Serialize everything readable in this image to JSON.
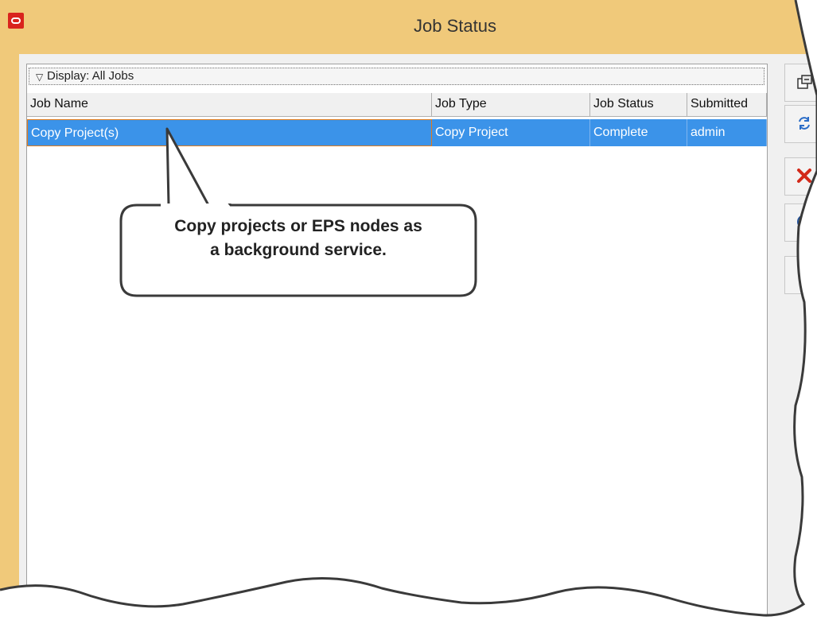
{
  "window": {
    "title": "Job Status"
  },
  "display_filter": {
    "label": "Display: All Jobs"
  },
  "table": {
    "columns": [
      "Job Name",
      "Job Type",
      "Job Status",
      "Submitted"
    ],
    "rows": [
      {
        "job_name": "Copy Project(s)",
        "job_type": "Copy Project",
        "job_status": "Complete",
        "submitted": "admin"
      }
    ]
  },
  "toolbar": {
    "buttons": [
      {
        "icon": "export-icon"
      },
      {
        "icon": "refresh-icon"
      },
      {
        "icon": "delete-icon"
      },
      {
        "icon": "help-icon"
      },
      {
        "icon": "blank-button"
      }
    ]
  },
  "callout": {
    "line1": "Copy projects or EPS nodes as",
    "line2": "a background service."
  },
  "colors": {
    "titlebar": "#f0c97a",
    "selection": "#3b93e9",
    "selection_border": "#e07a1a",
    "oracle_red": "#d9241d"
  }
}
